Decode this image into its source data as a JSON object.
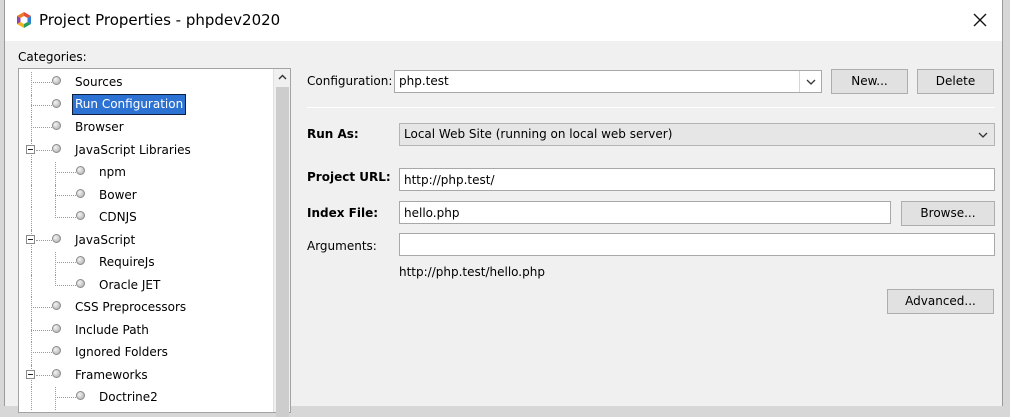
{
  "window": {
    "title": "Project Properties - phpdev2020"
  },
  "categories": {
    "label": "Categories:",
    "items": [
      {
        "label": "Sources",
        "level": 0,
        "expander": false,
        "selected": false
      },
      {
        "label": "Run Configuration",
        "level": 0,
        "expander": false,
        "selected": true
      },
      {
        "label": "Browser",
        "level": 0,
        "expander": false,
        "selected": false
      },
      {
        "label": "JavaScript Libraries",
        "level": 0,
        "expander": true,
        "selected": false
      },
      {
        "label": "npm",
        "level": 1,
        "expander": false,
        "selected": false
      },
      {
        "label": "Bower",
        "level": 1,
        "expander": false,
        "selected": false
      },
      {
        "label": "CDNJS",
        "level": 1,
        "expander": false,
        "selected": false
      },
      {
        "label": "JavaScript",
        "level": 0,
        "expander": true,
        "selected": false
      },
      {
        "label": "RequireJs",
        "level": 1,
        "expander": false,
        "selected": false
      },
      {
        "label": "Oracle JET",
        "level": 1,
        "expander": false,
        "selected": false
      },
      {
        "label": "CSS Preprocessors",
        "level": 0,
        "expander": false,
        "selected": false
      },
      {
        "label": "Include Path",
        "level": 0,
        "expander": false,
        "selected": false
      },
      {
        "label": "Ignored Folders",
        "level": 0,
        "expander": false,
        "selected": false
      },
      {
        "label": "Frameworks",
        "level": 0,
        "expander": true,
        "selected": false
      },
      {
        "label": "Doctrine2",
        "level": 1,
        "expander": false,
        "selected": false
      }
    ]
  },
  "config": {
    "configuration_label": "Configuration:",
    "configuration_value": "php.test",
    "new_button": "New...",
    "delete_button": "Delete",
    "run_as_label": "Run As:",
    "run_as_value": "Local Web Site (running on local web server)",
    "project_url_label": "Project URL:",
    "project_url_value": "http://php.test/",
    "index_file_label": "Index File:",
    "index_file_value": "hello.php",
    "browse_button": "Browse...",
    "arguments_label": "Arguments:",
    "arguments_value": "",
    "resolved_url": "http://php.test/hello.php",
    "advanced_button": "Advanced..."
  }
}
